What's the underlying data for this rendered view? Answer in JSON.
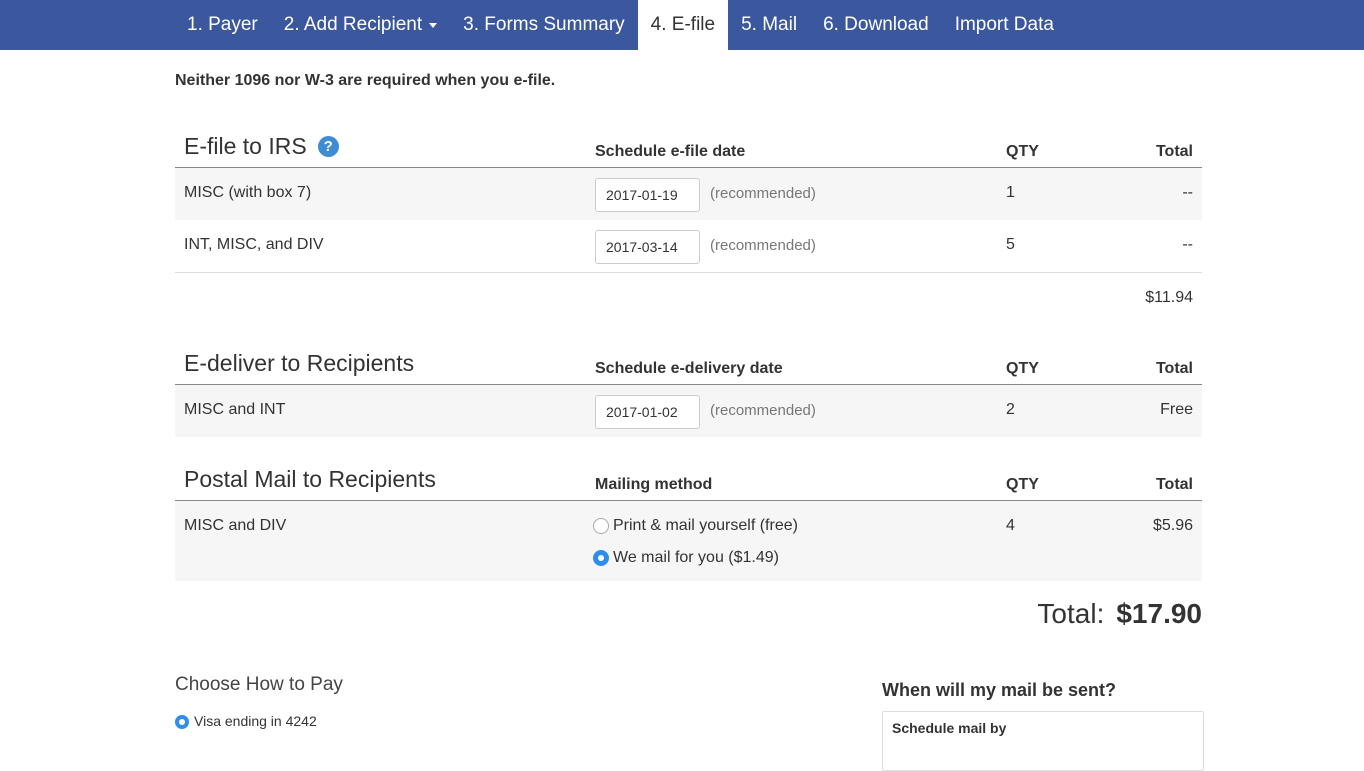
{
  "nav": {
    "tabs": [
      {
        "label": "1. Payer"
      },
      {
        "label": "2. Add Recipient"
      },
      {
        "label": "3. Forms Summary"
      },
      {
        "label": "4. E-file"
      },
      {
        "label": "5. Mail"
      },
      {
        "label": "6. Download"
      },
      {
        "label": "Import Data"
      }
    ],
    "active_tab": "4. E-file"
  },
  "notice": "Neither 1096 nor W-3 are required when you e-file.",
  "efile": {
    "title": "E-file to IRS",
    "help_icon": "question-circle-icon",
    "col_schedule": "Schedule e-file date",
    "col_qty": "QTY",
    "col_total": "Total",
    "rows": [
      {
        "name": "MISC (with box 7)",
        "date": "2017-01-19",
        "note": "(recommended)",
        "qty": "1",
        "total": "--"
      },
      {
        "name": "INT, MISC, and DIV",
        "date": "2017-03-14",
        "note": "(recommended)",
        "qty": "5",
        "total": "--"
      }
    ],
    "subtotal": "$11.94"
  },
  "edeliver": {
    "title": "E-deliver to Recipients",
    "col_schedule": "Schedule e-delivery date",
    "col_qty": "QTY",
    "col_total": "Total",
    "rows": [
      {
        "name": "MISC and INT",
        "date": "2017-01-02",
        "note": "(recommended)",
        "qty": "2",
        "total": "Free"
      }
    ]
  },
  "postal": {
    "title": "Postal Mail to Recipients",
    "col_method": "Mailing method",
    "col_qty": "QTY",
    "col_total": "Total",
    "row": {
      "name": "MISC and DIV",
      "options": [
        {
          "label": "Print & mail yourself (free)",
          "checked": false
        },
        {
          "label": "We mail for you ($1.49)",
          "checked": true
        }
      ],
      "qty": "4",
      "total": "$5.96"
    }
  },
  "grand_total": {
    "label": "Total:",
    "amount": "$17.90"
  },
  "payment": {
    "title": "Choose How to Pay",
    "option": "Visa ending in 4242",
    "checked": true
  },
  "mail_info": {
    "question": "When will my mail be sent?",
    "box_label": "Schedule mail by"
  },
  "colors": {
    "nav_bg": "#3b579d",
    "accent": "#2f8eed",
    "help_icon": "#3c8dd5"
  }
}
